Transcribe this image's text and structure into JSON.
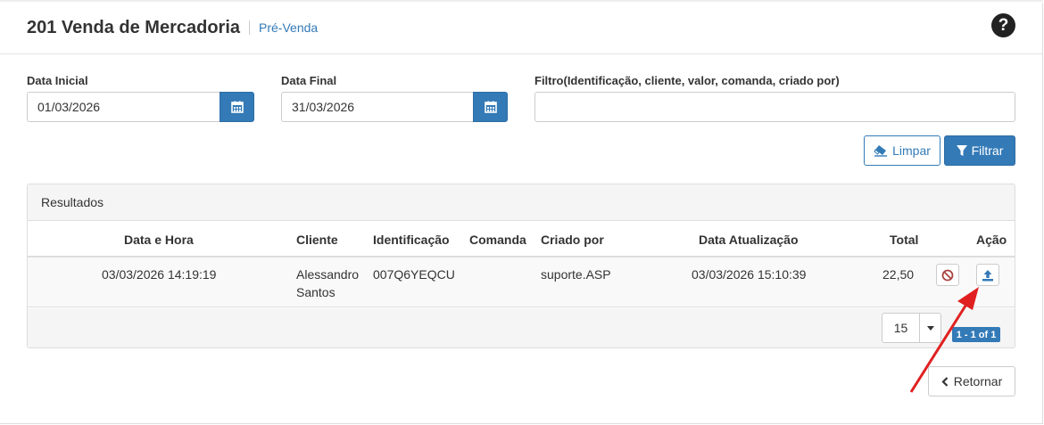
{
  "header": {
    "title": "201 Venda de Mercadoria",
    "subtitle": "Pré-Venda",
    "help_icon": "question-circle-icon"
  },
  "filters": {
    "data_inicial_label": "Data Inicial",
    "data_inicial_value": "01/03/2026",
    "data_final_label": "Data Final",
    "data_final_value": "31/03/2026",
    "filtro_label": "Filtro(Identificação, cliente, valor, comanda, criado por)",
    "filtro_value": "",
    "limpar_label": "Limpar",
    "filtrar_label": "Filtrar"
  },
  "results": {
    "heading": "Resultados",
    "columns": [
      "Data e Hora",
      "Cliente",
      "Identificação",
      "Comanda",
      "Criado por",
      "Data Atualização",
      "Total",
      "Ação"
    ],
    "rows": [
      {
        "data_hora": "03/03/2026 14:19:19",
        "cliente_line1": "Alessandro",
        "cliente_line2": "Santos",
        "identificacao": "007Q6YEQCU",
        "comanda": "",
        "criado_por": "suporte.ASP",
        "data_atualizacao": "03/03/2026 15:10:39",
        "total": "22,50"
      }
    ],
    "page_size": "15",
    "pager": "1 - 1 of 1"
  },
  "footer": {
    "retornar_label": "Retornar"
  },
  "colors": {
    "primary": "#337ab7",
    "danger": "#a94442",
    "annotation_arrow": "#e02020"
  }
}
